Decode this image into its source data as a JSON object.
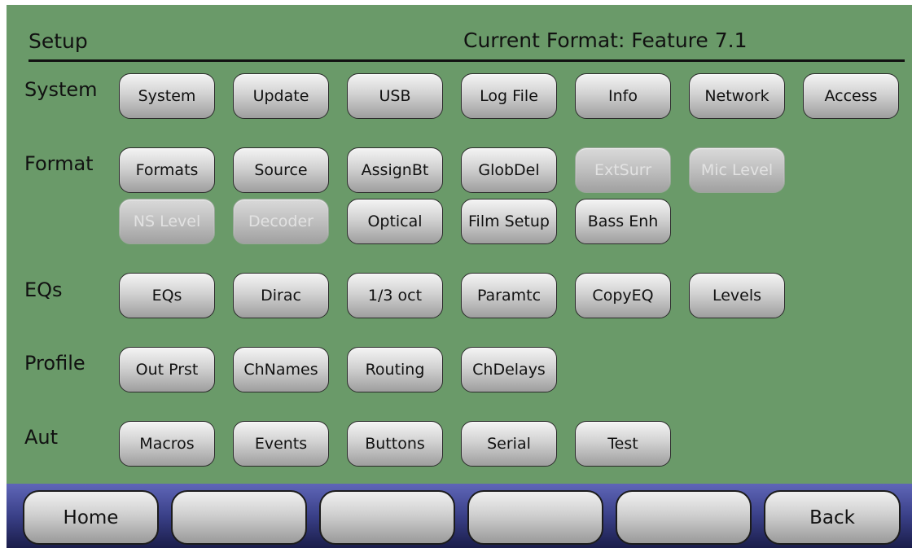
{
  "header": {
    "title": "Setup",
    "current_format": "Current Format: Feature 7.1"
  },
  "rows": {
    "system": {
      "label": "System",
      "buttons": [
        "System",
        "Update",
        "USB",
        "Log File",
        "Info",
        "Network",
        "Access"
      ]
    },
    "format": {
      "label": "Format",
      "buttons": [
        "Formats",
        "Source",
        "AssignBt",
        "GlobDel",
        "ExtSurr",
        "Mic Level",
        "NS Level",
        "Decoder",
        "Optical",
        "Film Setup",
        "Bass Enh"
      ],
      "disabled_buttons": [
        "ExtSurr",
        "Mic Level",
        "NS Level",
        "Decoder"
      ]
    },
    "eqs": {
      "label": "EQs",
      "buttons": [
        "EQs",
        "Dirac",
        "1/3 oct",
        "Paramtc",
        "CopyEQ",
        "Levels"
      ]
    },
    "profile": {
      "label": "Profile",
      "buttons": [
        "Out Prst",
        "ChNames",
        "Routing",
        "ChDelays"
      ]
    },
    "aut": {
      "label": "Aut",
      "buttons": [
        "Macros",
        "Events",
        "Buttons",
        "Serial",
        "Test"
      ]
    }
  },
  "bottom_nav": {
    "buttons": [
      "Home",
      "",
      "",
      "",
      "",
      "Back"
    ]
  },
  "colors": {
    "screen_background": "#6a9a69",
    "bottom_bar": "#3a4088",
    "button_face": "#cfcfcf",
    "disabled_text": "#e2e2e2"
  }
}
